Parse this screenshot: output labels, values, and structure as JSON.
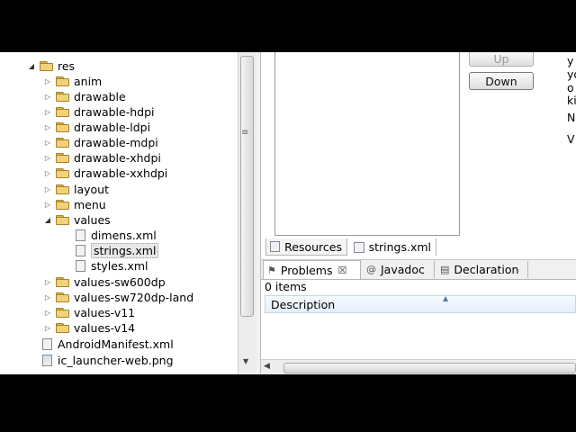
{
  "tree": {
    "res": "res",
    "folders_top": [
      "anim",
      "drawable",
      "drawable-hdpi",
      "drawable-ldpi",
      "drawable-mdpi",
      "drawable-xhdpi",
      "drawable-xxhdpi",
      "layout",
      "menu"
    ],
    "values": "values",
    "values_files": [
      "dimens.xml",
      "strings.xml",
      "styles.xml"
    ],
    "folders_bottom": [
      "values-sw600dp",
      "values-sw720dp-land",
      "values-v11",
      "values-v14"
    ],
    "files": [
      "AndroidManifest.xml",
      "ic_launcher-web.png"
    ]
  },
  "editor": {
    "up_button": "Up",
    "down_button": "Down",
    "side_text": [
      "y",
      "yo",
      "o",
      "ki",
      "N",
      "V"
    ],
    "tabs": [
      "Resources",
      "strings.xml"
    ]
  },
  "problems": {
    "tabs": [
      "Problems",
      "Javadoc",
      "Declaration"
    ],
    "count": "0 items",
    "column": "Description"
  }
}
